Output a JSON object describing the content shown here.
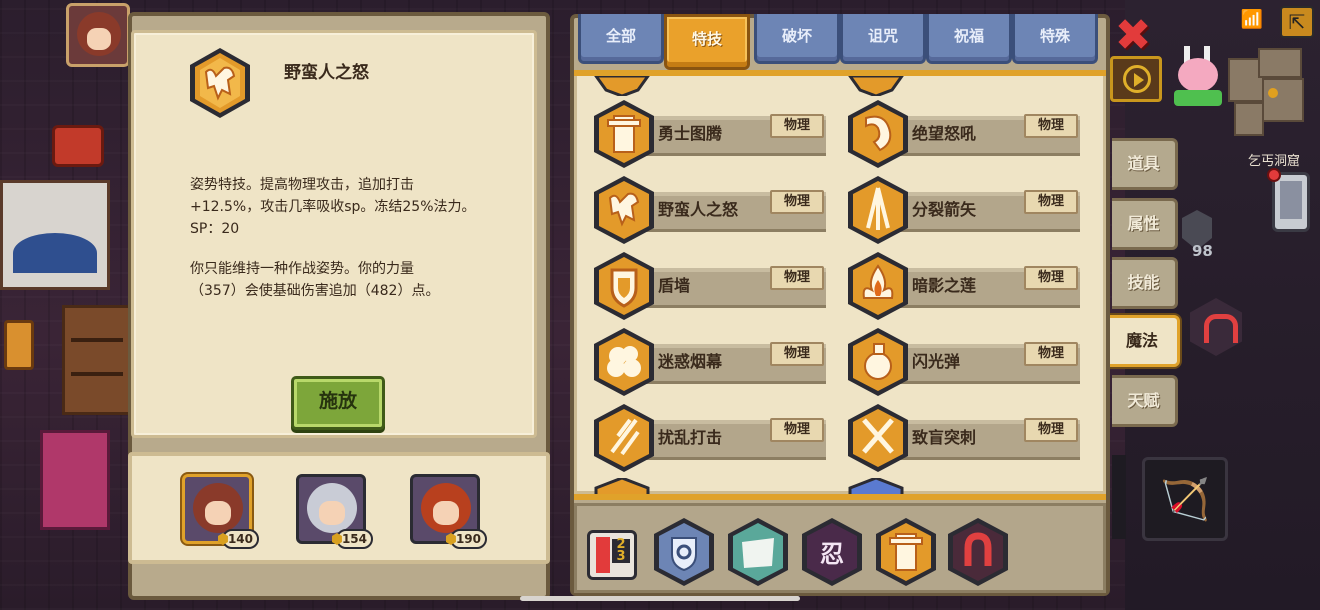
{
  "detail": {
    "title": "野蛮人之怒",
    "description_1": "姿势特技。提高物理攻击，追加打击\n+12.5%，攻击几率吸收sp。冻结25%法力。\nSP：20",
    "description_2": "你只能维持一种作战姿势。你的力量\n（357）会使基础伤害追加（482）点。",
    "cast_label": "施放"
  },
  "party": [
    {
      "level": "140",
      "hair": "#8a3a2a",
      "selected": true
    },
    {
      "level": "154",
      "hair": "#c9ccd6",
      "selected": false
    },
    {
      "level": "190",
      "hair": "#b8401e",
      "selected": false
    }
  ],
  "tabs": [
    {
      "label": "全部",
      "active": false
    },
    {
      "label": "特技",
      "active": true
    },
    {
      "label": "破坏",
      "active": false
    },
    {
      "label": "诅咒",
      "active": false
    },
    {
      "label": "祝福",
      "active": false
    },
    {
      "label": "特殊",
      "active": false
    }
  ],
  "skills": [
    {
      "name": "勇士图腾",
      "tag": "物理",
      "icon": "totem-icon"
    },
    {
      "name": "绝望怒吼",
      "tag": "物理",
      "icon": "roar-icon"
    },
    {
      "name": "野蛮人之怒",
      "tag": "物理",
      "icon": "barbarian-rage-icon"
    },
    {
      "name": "分裂箭矢",
      "tag": "物理",
      "icon": "split-arrow-icon"
    },
    {
      "name": "盾墙",
      "tag": "物理",
      "icon": "shield-wall-icon"
    },
    {
      "name": "暗影之莲",
      "tag": "物理",
      "icon": "shadow-lotus-icon"
    },
    {
      "name": "迷惑烟幕",
      "tag": "物理",
      "icon": "smoke-screen-icon"
    },
    {
      "name": "闪光弹",
      "tag": "物理",
      "icon": "flash-bomb-icon"
    },
    {
      "name": "扰乱打击",
      "tag": "物理",
      "icon": "disrupt-strike-icon"
    },
    {
      "name": "致盲突刺",
      "tag": "物理",
      "icon": "blinding-thrust-icon"
    }
  ],
  "side_tabs": [
    {
      "label": "道具",
      "active": false
    },
    {
      "label": "属性",
      "active": false
    },
    {
      "label": "技能",
      "active": false
    },
    {
      "label": "魔法",
      "active": true
    },
    {
      "label": "天赋",
      "active": false
    }
  ],
  "quick_slots": [
    "skill-order-icon",
    "rune-shield-icon",
    "map-scroll-icon",
    "ninja-icon",
    "totem-icon",
    "magnet-icon"
  ],
  "hud": {
    "location": "乞丐洞窟",
    "badge_count": "98"
  },
  "colors": {
    "panel": "#b8aa8c",
    "parchment": "#efe4c6",
    "accent_orange": "#eaa12b",
    "tab_blue": "#6d85b5",
    "cast_green": "#7da63a"
  }
}
